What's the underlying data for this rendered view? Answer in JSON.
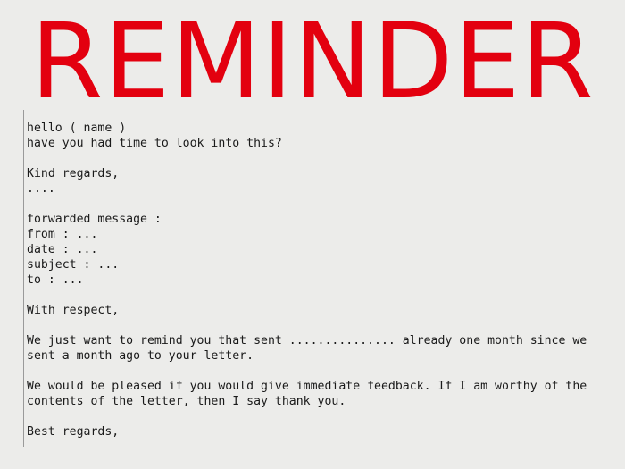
{
  "title": "REMINDER",
  "colors": {
    "title": "#e3000f",
    "background": "#ececea",
    "text": "#1a1a1a"
  },
  "letter": {
    "lines": [
      "hello ( name )",
      "have you had time to look into this?",
      "",
      "Kind regards,",
      "....",
      "",
      "forwarded message :",
      "from : ...",
      "date : ...",
      "subject : ...",
      "to : ...",
      "",
      "With respect,",
      "",
      "We just want to remind you that sent ............... already one month since we",
      "sent a month ago to your letter.",
      "",
      "We would be pleased if you would give immediate feedback. If I am worthy of the",
      "contents of the letter, then I say thank you.",
      "",
      "Best regards,"
    ]
  }
}
